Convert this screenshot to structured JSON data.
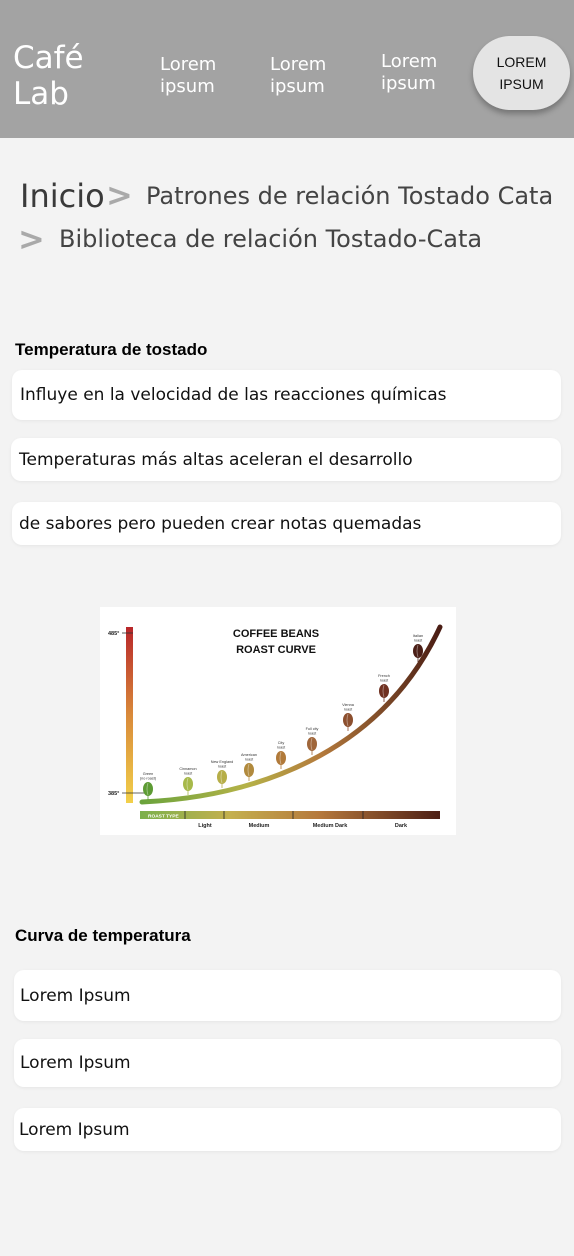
{
  "header": {
    "brand": "Café\nLab",
    "nav": [
      "Lorem\nipsum",
      "Lorem\nipsum",
      "Lorem\nipsum"
    ],
    "cta": "LOREM\nIPSUM"
  },
  "breadcrumb": {
    "home": "Inicio",
    "level2": "Patrones de relación Tostado Cata",
    "level3": "Biblioteca de relación Tostado-Cata",
    "separator": ">"
  },
  "section1": {
    "title": "Temperatura de tostado",
    "items": [
      "Influye en la velocidad de las reacciones químicas",
      "Temperaturas más altas aceleran el desarrollo",
      "de sabores pero pueden crear notas quemadas"
    ]
  },
  "figure": {
    "title_line1": "COFFEE BEANS",
    "title_line2": "ROAST CURVE",
    "temp_high": "485°",
    "temp_low": "385°",
    "roast_type_label": "ROAST TYPE",
    "roast_levels": [
      "Light",
      "Medium",
      "Medium Dark",
      "Dark"
    ],
    "beans": [
      {
        "label1": "Green",
        "label2": "(no roast)",
        "color": "#5d9b34"
      },
      {
        "label1": "Cinnamon",
        "label2": "roast",
        "color": "#a7b94a"
      },
      {
        "label1": "New England",
        "label2": "roast",
        "color": "#b6ae48"
      },
      {
        "label1": "American",
        "label2": "roast",
        "color": "#b18a3d"
      },
      {
        "label1": "City",
        "label2": "roast",
        "color": "#b17a3a"
      },
      {
        "label1": "Full city",
        "label2": "roast",
        "color": "#a0663a"
      },
      {
        "label1": "Vienna",
        "label2": "roast",
        "color": "#8c4f2e"
      },
      {
        "label1": "French",
        "label2": "roast",
        "color": "#6f3020"
      },
      {
        "label1": "Italian",
        "label2": "roast",
        "color": "#4b1f17"
      }
    ]
  },
  "section2": {
    "title": "Curva de temperatura",
    "items": [
      "Lorem Ipsum",
      "Lorem Ipsum",
      "Lorem Ipsum"
    ]
  },
  "colors": {
    "header_bg": "#a3a3a3",
    "page_bg": "#f3f3f3",
    "card_bg": "#ffffff",
    "separator": "#a9a9a9"
  }
}
